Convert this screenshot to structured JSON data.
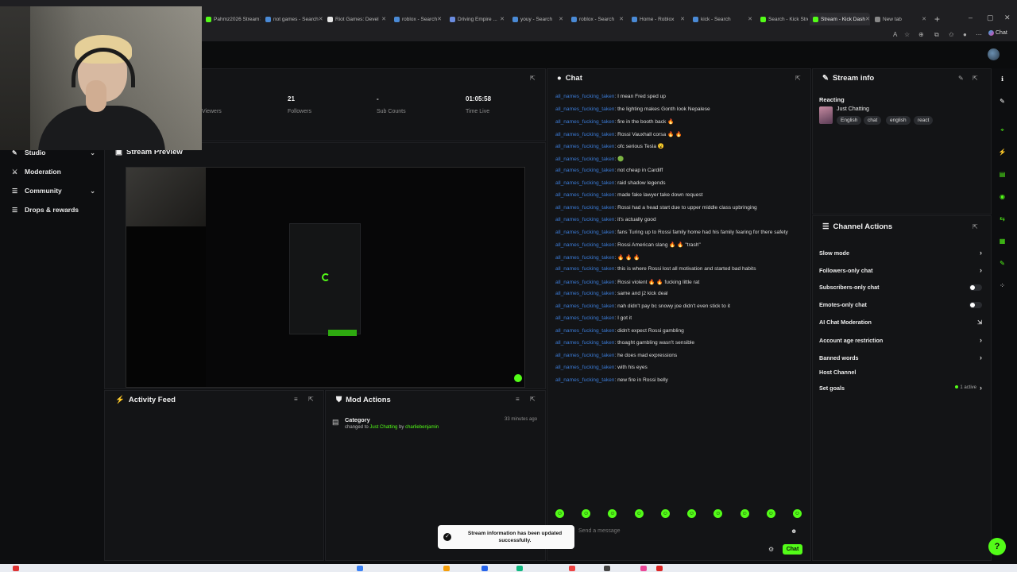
{
  "browser": {
    "tabs": [
      {
        "label": "Pahmz2026 Stream",
        "color": "#53fc18"
      },
      {
        "label": "not games - Search",
        "color": "#4a8ad6"
      },
      {
        "label": "Riot Games: Devel",
        "color": "#e6e6e6"
      },
      {
        "label": "roblox - Search",
        "color": "#4a8ad6"
      },
      {
        "label": "Driving Empire ...",
        "color": "#6b8ce0"
      },
      {
        "label": "youy - Search",
        "color": "#4a8ad6"
      },
      {
        "label": "roblox - Search",
        "color": "#4a8ad6"
      },
      {
        "label": "Home - Roblox",
        "color": "#4a8ad6"
      },
      {
        "label": "kick - Search",
        "color": "#4a8ad6"
      },
      {
        "label": "Search - Kick Strea",
        "color": "#53fc18"
      },
      {
        "label": "Stream - Kick Dash",
        "color": "#53fc18"
      },
      {
        "label": "New tab",
        "color": "#888888"
      }
    ],
    "copilot_label": "Chat"
  },
  "sidebar": {
    "items": [
      {
        "label": "Studio",
        "icon": "pencil-icon",
        "has_chevron": true
      },
      {
        "label": "Moderation",
        "icon": "sword-icon",
        "has_chevron": false
      },
      {
        "label": "Community",
        "icon": "users-icon",
        "has_chevron": true
      },
      {
        "label": "Drops & rewards",
        "icon": "gift-icon",
        "has_chevron": false
      }
    ]
  },
  "stats": {
    "viewers_label": "Viewers",
    "followers_value": "21",
    "followers_label": "Followers",
    "subs_value": "-",
    "subs_label": "Sub Counts",
    "time_value": "01:05:58",
    "time_label": "Time Live"
  },
  "stream_preview": {
    "title": "Stream Preview"
  },
  "activity_feed": {
    "title": "Activity Feed"
  },
  "mod_actions": {
    "title": "Mod Actions",
    "entry": {
      "category": "Category",
      "time": "33 minutes ago",
      "prefix": "changed to",
      "value": "Just Chatting",
      "by": "by",
      "user": "charliebenjamin"
    }
  },
  "chat": {
    "title": "Chat",
    "messages": [
      {
        "user": "all_names_fucking_taken",
        "text": "I mean Fred sped up"
      },
      {
        "user": "all_names_fucking_taken",
        "text": "the lighting makes Gonth look Nepalese"
      },
      {
        "user": "all_names_fucking_taken",
        "text": "fire in the booth back 🔥"
      },
      {
        "user": "all_names_fucking_taken",
        "text": "Rossi Vauxhall corsa 🔥 🔥"
      },
      {
        "user": "all_names_fucking_taken",
        "text": "ofc serious Tesla 😮"
      },
      {
        "user": "all_names_fucking_taken",
        "text": "🟢"
      },
      {
        "user": "all_names_fucking_taken",
        "text": "not cheap in Cardiff"
      },
      {
        "user": "all_names_fucking_taken",
        "text": "raid shadow legends"
      },
      {
        "user": "all_names_fucking_taken",
        "text": "made fake lawyer take down request"
      },
      {
        "user": "all_names_fucking_taken",
        "text": "Rossi had a head start due to upper middle class upbringing"
      },
      {
        "user": "all_names_fucking_taken",
        "text": "it's actually good"
      },
      {
        "user": "all_names_fucking_taken",
        "text": "fans Turing up to Rossi family home had his family fearing for there safety"
      },
      {
        "user": "all_names_fucking_taken",
        "text": "Rossi American slang 🔥 🔥 \"trash\""
      },
      {
        "user": "all_names_fucking_taken",
        "text": "🔥 🔥 🔥"
      },
      {
        "user": "all_names_fucking_taken",
        "text": "this is where Rossi lost all motivation and started bad habits"
      },
      {
        "user": "all_names_fucking_taken",
        "text": "Rossi violent 🔥 🔥 fucking little rat"
      },
      {
        "user": "all_names_fucking_taken",
        "text": "same and j2 kick deal"
      },
      {
        "user": "all_names_fucking_taken",
        "text": "nah didn't pay bc snowy joe didn't even stick to it"
      },
      {
        "user": "all_names_fucking_taken",
        "text": "I got it"
      },
      {
        "user": "all_names_fucking_taken",
        "text": "didn't expect Rossi gambling"
      },
      {
        "user": "all_names_fucking_taken",
        "text": "thoaght gambling wasn't sensible"
      },
      {
        "user": "all_names_fucking_taken",
        "text": "he does mad expressions"
      },
      {
        "user": "all_names_fucking_taken",
        "text": "with his eyes"
      },
      {
        "user": "all_names_fucking_taken",
        "text": "new fire in Rossi belly"
      }
    ],
    "input_placeholder": "Send a message",
    "send_label": "Chat"
  },
  "stream_info": {
    "title": "Stream info",
    "stream_title": "Reacting",
    "category": "Just Chatting",
    "tags": [
      "English",
      "chat",
      "english",
      "react"
    ]
  },
  "channel_actions": {
    "title": "Channel Actions",
    "items": [
      {
        "label": "Slow mode",
        "control": "arrow"
      },
      {
        "label": "Followers-only chat",
        "control": "arrow"
      },
      {
        "label": "Subscribers-only chat",
        "control": "toggle"
      },
      {
        "label": "Emotes-only chat",
        "control": "toggle"
      },
      {
        "label": "AI Chat Moderation",
        "control": "external"
      },
      {
        "label": "Account age restriction",
        "control": "arrow"
      },
      {
        "label": "Banned words",
        "control": "arrow"
      },
      {
        "label": "Host Channel",
        "control": "none"
      },
      {
        "label": "Set goals",
        "control": "arrow",
        "badge": "1 active"
      }
    ]
  },
  "toast": {
    "message": "Stream information has been updated successfully."
  },
  "colors": {
    "accent": "#53fc18",
    "username": "#3b7bd6",
    "panel": "#131416"
  }
}
